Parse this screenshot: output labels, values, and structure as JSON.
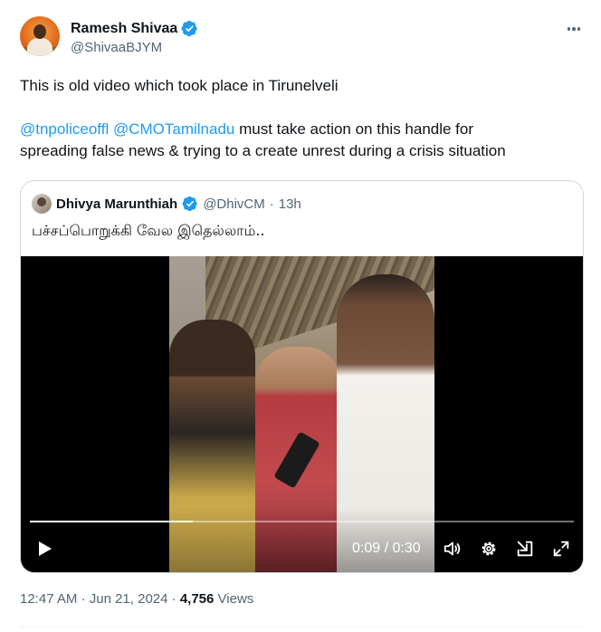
{
  "author": {
    "display_name": "Ramesh Shivaa",
    "handle": "@ShivaaBJYM",
    "verified": true
  },
  "tweet": {
    "line1": "This is old video which took place in Tirunelveli",
    "mention1": "@tnpoliceoffl",
    "mention2": "@CMOTamilnadu",
    "line2_rest": " must take action on this handle for",
    "line3": "spreading false news & trying to a create unrest during a crisis situation"
  },
  "quote": {
    "display_name": "Dhivya Marunthiah",
    "handle": "@DhivCM",
    "separator": "·",
    "time_ago": "13h",
    "text": "பச்சப்பொறுக்கி வேல இதெல்லாம்..",
    "video": {
      "time_display": "0:09 / 0:30",
      "progress": 0.3
    }
  },
  "meta": {
    "time": "12:47 AM",
    "sep1": "·",
    "date": "Jun 21, 2024",
    "sep2": "·",
    "views_count": "4,756",
    "views_label": "Views"
  },
  "colors": {
    "link": "#1d9bf0",
    "verified": "#1d9bf0",
    "muted": "#536471",
    "border": "#cfd9de"
  },
  "icons": [
    "more-icon",
    "verified-icon",
    "play-icon",
    "volume-icon",
    "settings-icon",
    "exit-icon",
    "fullscreen-icon"
  ]
}
